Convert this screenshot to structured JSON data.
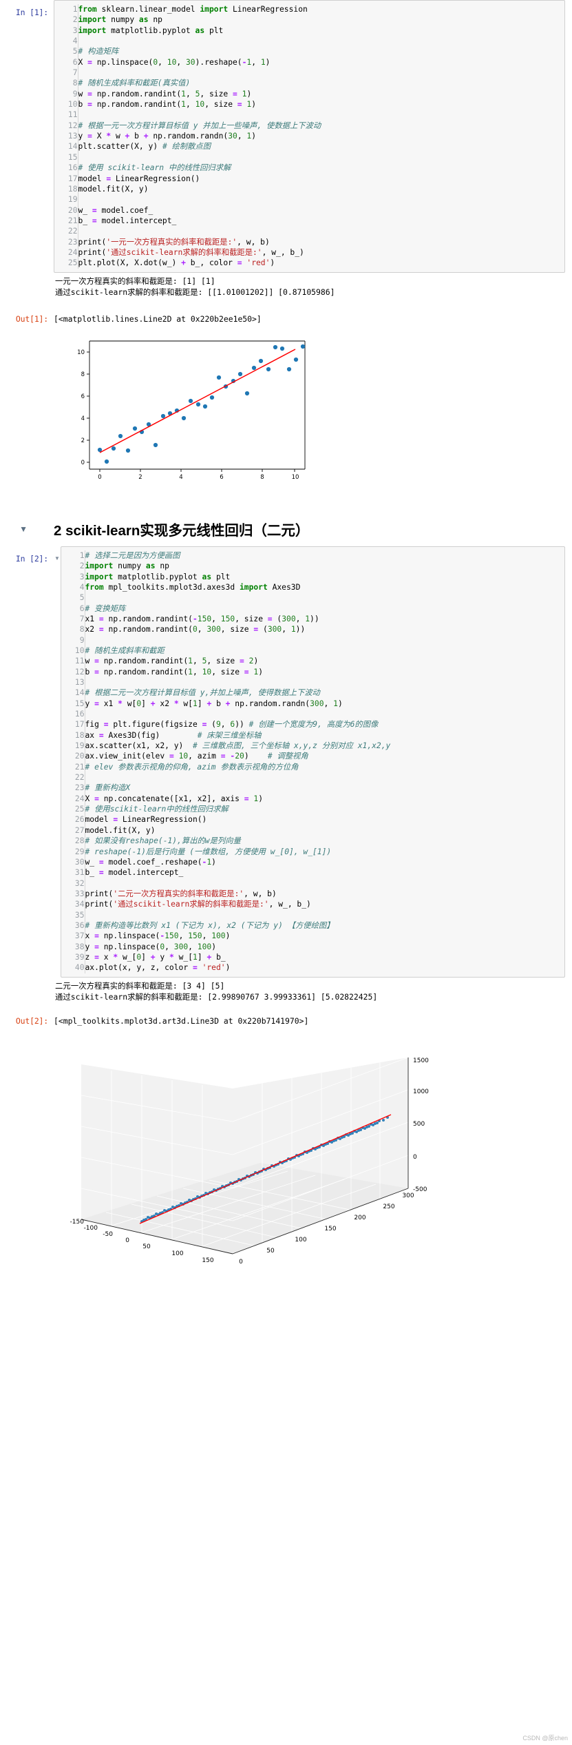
{
  "cells": [
    {
      "prompt": "In [1]:",
      "lines": [
        {
          "n": 1,
          "html": "<span class=\"kw\">from</span> sklearn.linear_model <span class=\"kw\">import</span> LinearRegression"
        },
        {
          "n": 2,
          "html": "<span class=\"kw\">import</span> numpy <span class=\"kw\">as</span> np"
        },
        {
          "n": 3,
          "html": "<span class=\"kw\">import</span> matplotlib.pyplot <span class=\"kw\">as</span> plt"
        },
        {
          "n": 4,
          "html": ""
        },
        {
          "n": 5,
          "html": "<span class=\"cm\"># 构造矩阵</span>"
        },
        {
          "n": 6,
          "html": "X <span class=\"op\">=</span> np.linspace(<span class=\"num\">0</span>, <span class=\"num\">10</span>, <span class=\"num\">30</span>).reshape(<span class=\"op\">-</span><span class=\"num\">1</span>, <span class=\"num\">1</span>)"
        },
        {
          "n": 7,
          "html": ""
        },
        {
          "n": 8,
          "html": "<span class=\"cm\"># 随机生成斜率和截距(真实值)</span>"
        },
        {
          "n": 9,
          "html": "w <span class=\"op\">=</span> np.random.randint(<span class=\"num\">1</span>, <span class=\"num\">5</span>, size <span class=\"op\">=</span> <span class=\"num\">1</span>)"
        },
        {
          "n": 10,
          "html": "b <span class=\"op\">=</span> np.random.randint(<span class=\"num\">1</span>, <span class=\"num\">10</span>, size <span class=\"op\">=</span> <span class=\"num\">1</span>)"
        },
        {
          "n": 11,
          "html": ""
        },
        {
          "n": 12,
          "html": "<span class=\"cm\"># 根据一元一次方程计算目标值 y 并加上一些噪声, 使数据上下波动</span>"
        },
        {
          "n": 13,
          "html": "y <span class=\"op\">=</span> X <span class=\"op\">*</span> w <span class=\"op\">+</span> b <span class=\"op\">+</span> np.random.randn(<span class=\"num\">30</span>, <span class=\"num\">1</span>)"
        },
        {
          "n": 14,
          "html": "plt.scatter(X, y) <span class=\"cm\"># 绘制散点图</span>"
        },
        {
          "n": 15,
          "html": ""
        },
        {
          "n": 16,
          "html": "<span class=\"cm\"># 使用 scikit-learn 中的线性回归求解</span>"
        },
        {
          "n": 17,
          "html": "model <span class=\"op\">=</span> LinearRegression()"
        },
        {
          "n": 18,
          "html": "model.fit(X, y)"
        },
        {
          "n": 19,
          "html": ""
        },
        {
          "n": 20,
          "html": "w_ <span class=\"op\">=</span> model.coef_"
        },
        {
          "n": 21,
          "html": "b_ <span class=\"op\">=</span> model.intercept_"
        },
        {
          "n": 22,
          "html": ""
        },
        {
          "n": 23,
          "html": "print(<span class=\"str\">'一元一次方程真实的斜率和截距是:'</span>, w, b)"
        },
        {
          "n": 24,
          "html": "print(<span class=\"str\">'通过scikit-learn求解的斜率和截距是:'</span>, w_, b_)"
        },
        {
          "n": 25,
          "html": "plt.plot(X, X.dot(w_) <span class=\"op\">+</span> b_, color <span class=\"op\">=</span> <span class=\"str\">'red'</span>)"
        }
      ],
      "stdout": [
        "一元一次方程真实的斜率和截距是: [1] [1]",
        "通过scikit-learn求解的斜率和截距是: [[1.01001202]] [0.87105986]"
      ],
      "out_prompt": "Out[1]:",
      "out_text": "[<matplotlib.lines.Line2D at 0x220b2ee1e50>]"
    },
    {
      "prompt": "In [2]:",
      "lines": [
        {
          "n": 1,
          "html": "<span class=\"cm\"># 选择二元是因为方便画图</span>"
        },
        {
          "n": 2,
          "html": "<span class=\"kw\">import</span> numpy <span class=\"kw\">as</span> np"
        },
        {
          "n": 3,
          "html": "<span class=\"kw\">import</span> matplotlib.pyplot <span class=\"kw\">as</span> plt"
        },
        {
          "n": 4,
          "html": "<span class=\"kw\">from</span> mpl_toolkits.mplot3d.axes3d <span class=\"kw\">import</span> Axes3D"
        },
        {
          "n": 5,
          "html": ""
        },
        {
          "n": 6,
          "html": "<span class=\"cm\"># 变换矩阵</span>"
        },
        {
          "n": 7,
          "html": "x1 <span class=\"op\">=</span> np.random.randint(<span class=\"op\">-</span><span class=\"num\">150</span>, <span class=\"num\">150</span>, size <span class=\"op\">=</span> (<span class=\"num\">300</span>, <span class=\"num\">1</span>))"
        },
        {
          "n": 8,
          "html": "x2 <span class=\"op\">=</span> np.random.randint(<span class=\"num\">0</span>, <span class=\"num\">300</span>, size <span class=\"op\">=</span> (<span class=\"num\">300</span>, <span class=\"num\">1</span>))"
        },
        {
          "n": 9,
          "html": ""
        },
        {
          "n": 10,
          "html": "<span class=\"cm\"># 随机生成斜率和截距</span>"
        },
        {
          "n": 11,
          "html": "w <span class=\"op\">=</span> np.random.randint(<span class=\"num\">1</span>, <span class=\"num\">5</span>, size <span class=\"op\">=</span> <span class=\"num\">2</span>)"
        },
        {
          "n": 12,
          "html": "b <span class=\"op\">=</span> np.random.randint(<span class=\"num\">1</span>, <span class=\"num\">10</span>, size <span class=\"op\">=</span> <span class=\"num\">1</span>)"
        },
        {
          "n": 13,
          "html": ""
        },
        {
          "n": 14,
          "html": "<span class=\"cm\"># 根据二元一次方程计算目标值 y,并加上噪声, 使得数据上下波动</span>"
        },
        {
          "n": 15,
          "html": "y <span class=\"op\">=</span> x1 <span class=\"op\">*</span> w[<span class=\"num\">0</span>] <span class=\"op\">+</span> x2 <span class=\"op\">*</span> w[<span class=\"num\">1</span>] <span class=\"op\">+</span> b <span class=\"op\">+</span> np.random.randn(<span class=\"num\">300</span>, <span class=\"num\">1</span>)"
        },
        {
          "n": 16,
          "html": ""
        },
        {
          "n": 17,
          "html": "fig <span class=\"op\">=</span> plt.figure(figsize <span class=\"op\">=</span> (<span class=\"num\">9</span>, <span class=\"num\">6</span>)) <span class=\"cm\"># 创建一个宽度为9, 高度为6的图像</span>"
        },
        {
          "n": 18,
          "html": "ax <span class=\"op\">=</span> Axes3D(fig)        <span class=\"cm\"># 床架三维坐标轴</span>"
        },
        {
          "n": 19,
          "html": "ax.scatter(x1, x2, y)  <span class=\"cm\"># 三维散点图, 三个坐标轴 x,y,z 分别对应 x1,x2,y</span>"
        },
        {
          "n": 20,
          "html": "ax.view_init(elev <span class=\"op\">=</span> <span class=\"num\">10</span>, azim <span class=\"op\">=</span> <span class=\"op\">-</span><span class=\"num\">20</span>)    <span class=\"cm\"># 调整视角</span>"
        },
        {
          "n": 21,
          "html": "<span class=\"cm\"># elev 参数表示视角的仰角, azim 参数表示视角的方位角</span>"
        },
        {
          "n": 22,
          "html": ""
        },
        {
          "n": 23,
          "html": "<span class=\"cm\"># 重新构造X</span>"
        },
        {
          "n": 24,
          "html": "X <span class=\"op\">=</span> np.concatenate([x1, x2], axis <span class=\"op\">=</span> <span class=\"num\">1</span>)"
        },
        {
          "n": 25,
          "html": "<span class=\"cm\"># 使用scikit-learn中的线性回归求解</span>"
        },
        {
          "n": 26,
          "html": "model <span class=\"op\">=</span> LinearRegression()"
        },
        {
          "n": 27,
          "html": "model.fit(X, y)"
        },
        {
          "n": 28,
          "html": "<span class=\"cm\"># 如果没有reshape(-1),算出的w是列向量</span>"
        },
        {
          "n": 29,
          "html": "<span class=\"cm\"># reshape(-1)后是行向量 (一维数组, 方便使用 w_[0], w_[1])</span>"
        },
        {
          "n": 30,
          "html": "w_ <span class=\"op\">=</span> model.coef_.reshape(<span class=\"op\">-</span><span class=\"num\">1</span>)"
        },
        {
          "n": 31,
          "html": "b_ <span class=\"op\">=</span> model.intercept_"
        },
        {
          "n": 32,
          "html": ""
        },
        {
          "n": 33,
          "html": "print(<span class=\"str\">'二元一次方程真实的斜率和截距是:'</span>, w, b)"
        },
        {
          "n": 34,
          "html": "print(<span class=\"str\">'通过scikit-learn求解的斜率和截距是:'</span>, w_, b_)"
        },
        {
          "n": 35,
          "html": ""
        },
        {
          "n": 36,
          "html": "<span class=\"cm\"># 重新构造等比数列 x1 (下记为 x), x2 (下记为 y) 【方便绘图】</span>"
        },
        {
          "n": 37,
          "html": "x <span class=\"op\">=</span> np.linspace(<span class=\"op\">-</span><span class=\"num\">150</span>, <span class=\"num\">150</span>, <span class=\"num\">100</span>)"
        },
        {
          "n": 38,
          "html": "y <span class=\"op\">=</span> np.linspace(<span class=\"num\">0</span>, <span class=\"num\">300</span>, <span class=\"num\">100</span>)"
        },
        {
          "n": 39,
          "html": "z <span class=\"op\">=</span> x <span class=\"op\">*</span> w_[<span class=\"num\">0</span>] <span class=\"op\">+</span> y <span class=\"op\">*</span> w_[<span class=\"num\">1</span>] <span class=\"op\">+</span> b_"
        },
        {
          "n": 40,
          "html": "ax.plot(x, y, z, color <span class=\"op\">=</span> <span class=\"str\">'red'</span>)"
        }
      ],
      "stdout": [
        "二元一次方程真实的斜率和截距是: [3 4] [5]",
        "通过scikit-learn求解的斜率和截距是: [2.99890767 3.99933361] [5.02822425]"
      ],
      "out_prompt": "Out[2]:",
      "out_text": "[<mpl_toolkits.mplot3d.art3d.Line3D at 0x220b7141970>]"
    }
  ],
  "heading": {
    "caret": "▼",
    "text": "2  scikit-learn实现多元线性回归（二元）"
  },
  "watermark": "CSDN @原chen",
  "chart_data": [
    {
      "type": "scatter",
      "title": "",
      "xlabel": "",
      "ylabel": "",
      "xlim": [
        -0.5,
        10.5
      ],
      "ylim": [
        -0.5,
        12
      ],
      "xticks": [
        0,
        2,
        4,
        6,
        8,
        10
      ],
      "yticks": [
        0,
        2,
        4,
        6,
        8,
        10
      ],
      "grid": false,
      "series": [
        {
          "name": "data",
          "color": "#1f77b4",
          "marker": "o",
          "x": [
            0.0,
            0.345,
            0.69,
            1.034,
            1.379,
            1.724,
            2.069,
            2.414,
            2.759,
            3.103,
            3.448,
            3.793,
            4.138,
            4.483,
            4.828,
            5.172,
            5.517,
            5.862,
            6.207,
            6.552,
            6.897,
            7.241,
            7.586,
            7.931,
            8.276,
            8.621,
            8.966,
            9.31,
            9.655,
            10.0
          ],
          "y": [
            1.15,
            0.05,
            1.25,
            2.35,
            1.05,
            3.05,
            2.75,
            3.45,
            1.55,
            4.15,
            4.45,
            4.65,
            3.95,
            5.55,
            5.25,
            5.05,
            5.85,
            7.65,
            6.85,
            7.35,
            7.95,
            6.25,
            8.55,
            9.15,
            8.45,
            11.05,
            11.55,
            9.05,
            9.95,
            11.35
          ]
        },
        {
          "name": "fit-line",
          "color": "#ff0000",
          "marker": "line",
          "x": [
            0.0,
            10.0
          ],
          "y": [
            0.871,
            10.971
          ]
        }
      ]
    },
    {
      "type": "scatter3d",
      "title": "",
      "xlabel": "",
      "ylabel": "",
      "zlabel": "",
      "xticks": [
        -150,
        -100,
        -50,
        0,
        50,
        100,
        150
      ],
      "yticks": [
        0,
        50,
        100,
        150,
        200,
        250,
        300
      ],
      "zticks": [
        -500,
        0,
        500,
        1000,
        1500
      ],
      "grid": true,
      "series": [
        {
          "name": "points",
          "color": "#1f77b4",
          "marker": "o",
          "count": 300
        },
        {
          "name": "fit-line",
          "color": "#ff0000",
          "marker": "line"
        }
      ]
    }
  ]
}
